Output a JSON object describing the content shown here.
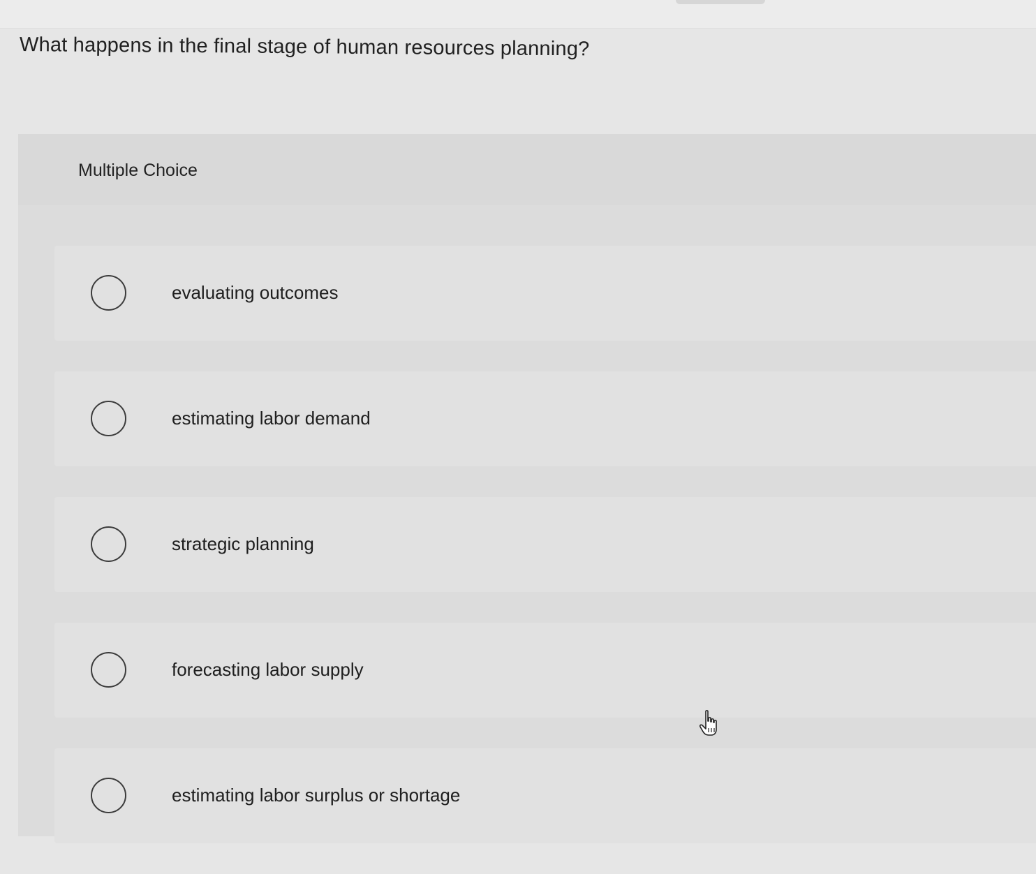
{
  "question": {
    "text": "What happens in the final stage of human resources planning?"
  },
  "question_type": {
    "label": "Multiple Choice"
  },
  "options": [
    {
      "label": "evaluating outcomes",
      "selected": false
    },
    {
      "label": "estimating labor demand",
      "selected": false
    },
    {
      "label": "strategic planning",
      "selected": false
    },
    {
      "label": "forecasting labor supply",
      "selected": false
    },
    {
      "label": "estimating labor surplus or shortage",
      "selected": false
    }
  ],
  "cursor": {
    "icon": "hand-pointer-icon"
  }
}
